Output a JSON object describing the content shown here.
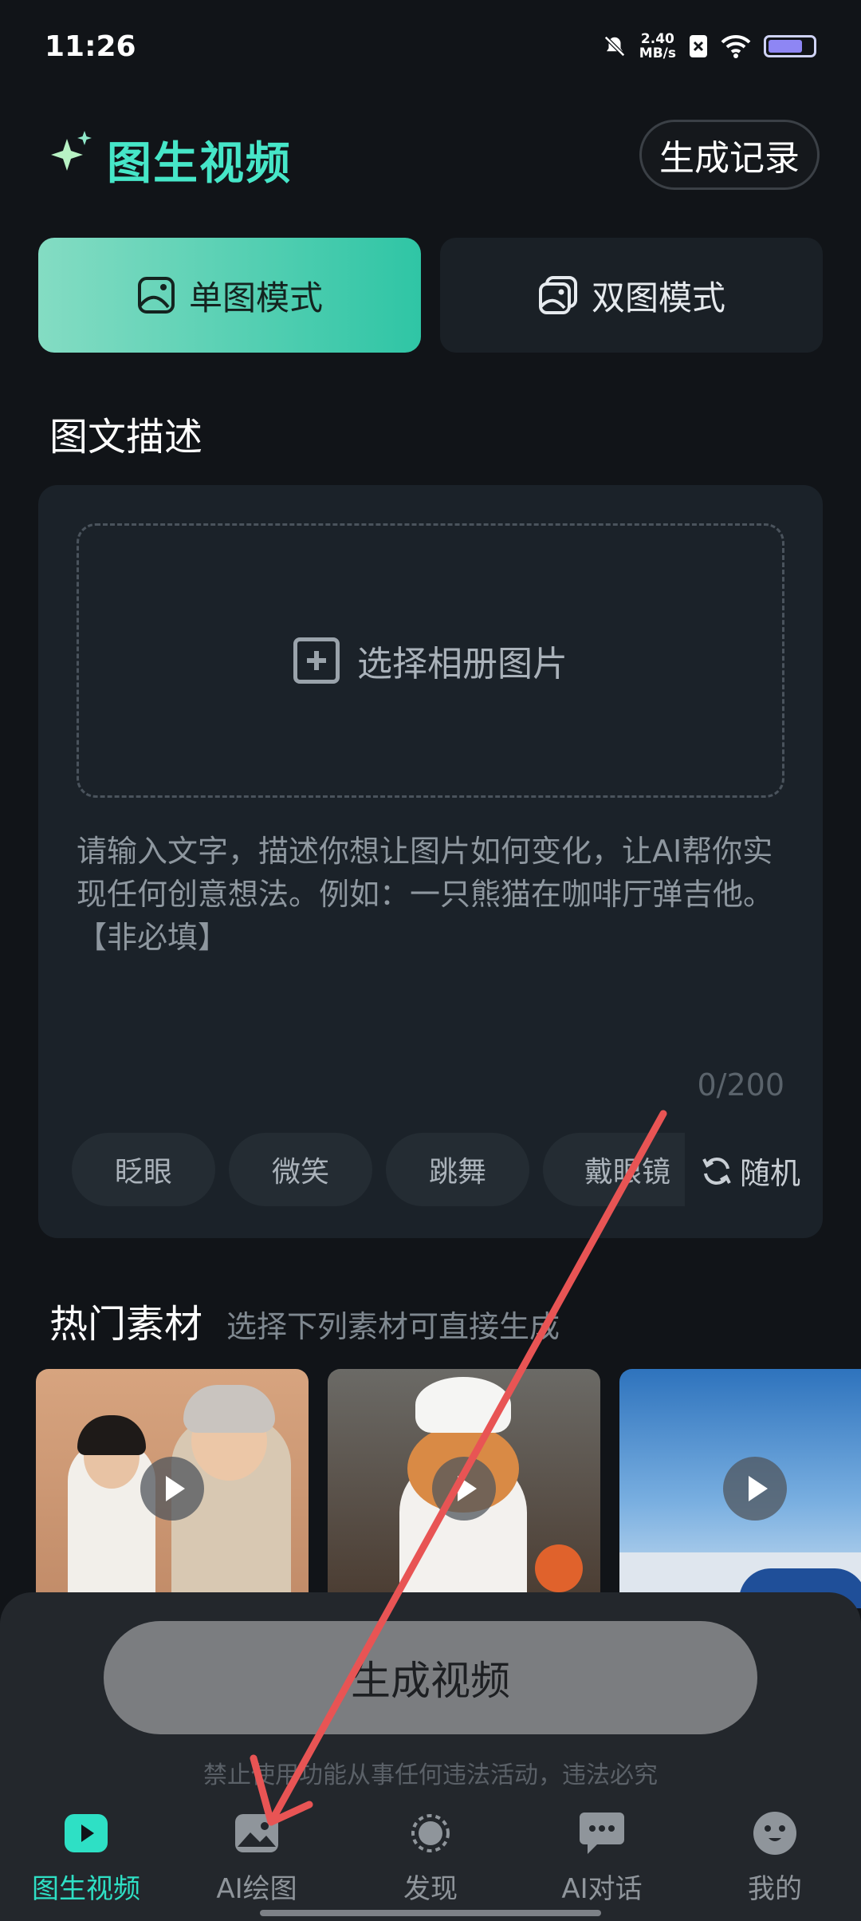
{
  "status_bar": {
    "time": "11:26",
    "speed_value": "2.40",
    "speed_unit": "MB/s"
  },
  "header": {
    "title": "图生视频",
    "record_button": "生成记录"
  },
  "modes": {
    "single": "单图模式",
    "double": "双图模式"
  },
  "description": {
    "section_title": "图文描述",
    "upload_label": "选择相册图片",
    "placeholder": "请输入文字，描述你想让图片如何变化，让AI帮你实现任何创意想法。例如：一只熊猫在咖啡厅弹吉他。【非必填】",
    "counter": "0/200",
    "chips": [
      "眨眼",
      "微笑",
      "跳舞",
      "戴眼镜"
    ],
    "random_label": "随机"
  },
  "hot": {
    "title": "热门素材",
    "subtitle": "选择下列素材可直接生成"
  },
  "generate": {
    "button": "生成视频",
    "notice": "禁止使用功能从事任何违法活动，违法必究"
  },
  "nav": [
    {
      "label": "图生视频",
      "icon": "video-play-icon",
      "active": true
    },
    {
      "label": "AI绘图",
      "icon": "image-icon",
      "active": false
    },
    {
      "label": "发现",
      "icon": "discover-icon",
      "active": false
    },
    {
      "label": "AI对话",
      "icon": "chat-icon",
      "active": false
    },
    {
      "label": "我的",
      "icon": "profile-icon",
      "active": false
    }
  ],
  "colors": {
    "accent": "#2ee0c5",
    "background": "#111418",
    "panel": "#1b2229",
    "annotation_arrow": "#e85454"
  }
}
